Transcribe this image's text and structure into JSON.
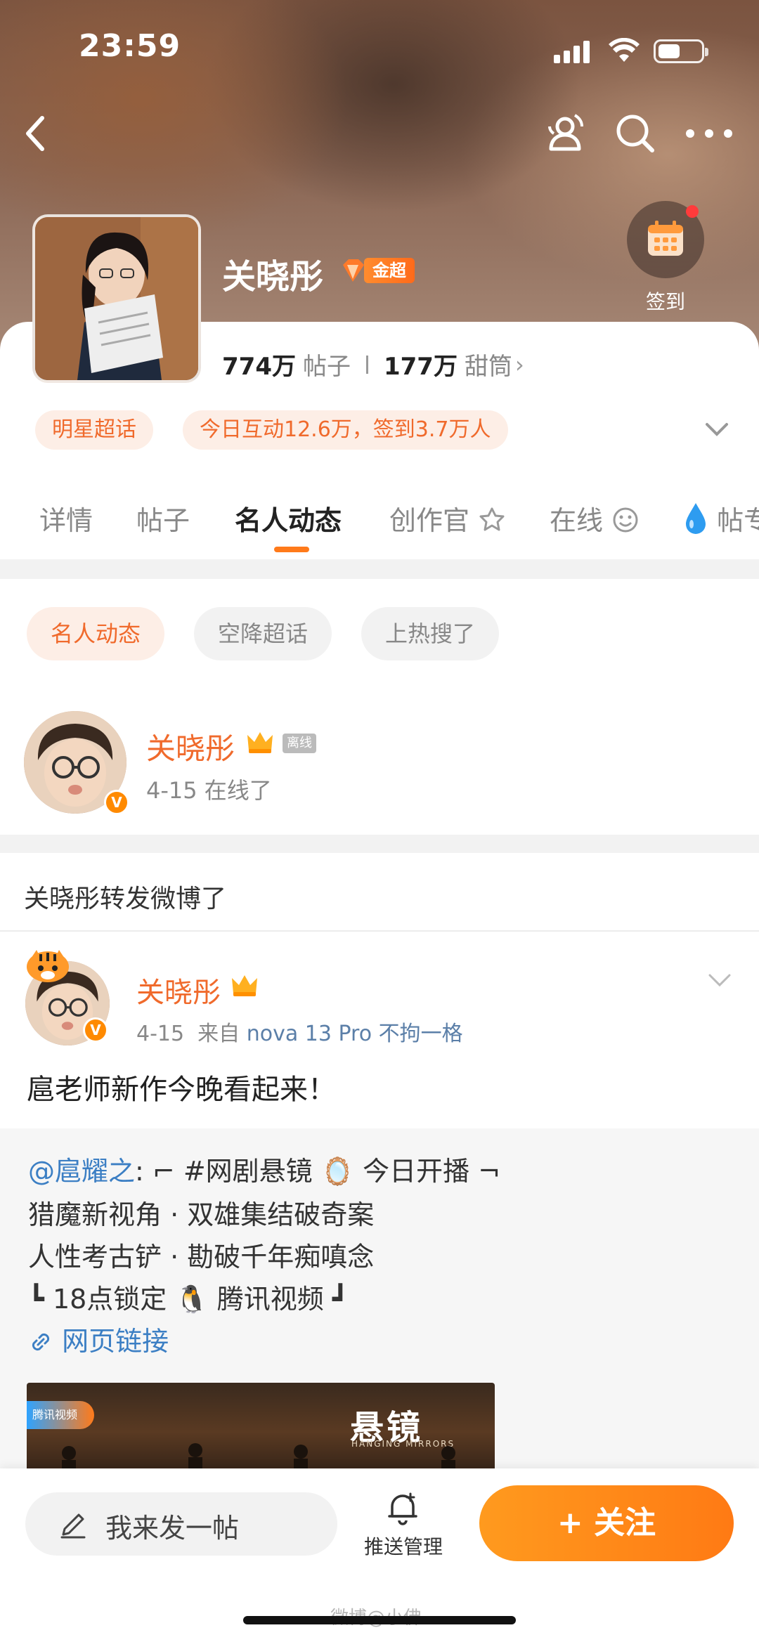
{
  "status_bar": {
    "time": "23:59"
  },
  "profile": {
    "name": "关晓彤",
    "level_badge": "金超",
    "posts_count": "774万",
    "posts_label": "帖子",
    "fans_count": "177万",
    "fans_label": "甜筒",
    "checkin_label": "签到"
  },
  "chips": {
    "category": "明星超话",
    "activity": "今日互动12.6万，签到3.7万人"
  },
  "tabs": [
    "详情",
    "帖子",
    "名人动态",
    "创作官",
    "在线",
    "帖专"
  ],
  "active_tab": "名人动态",
  "filters": [
    "名人动态",
    "空降超话",
    "上热搜了"
  ],
  "online_card": {
    "name": "关晓彤",
    "status_tag": "离线",
    "time": "4-15 在线了"
  },
  "repost": {
    "title": "关晓彤转发微博了",
    "author": "关晓彤",
    "date": "4-15",
    "from_prefix": "来自",
    "device": "nova 13 Pro 不拘一格",
    "text": "扈老师新作今晚看起来！",
    "quote": {
      "mention": "@扈耀之",
      "line1_rest": ": ⌐ #网剧悬镜 🪞 今日开播 ¬",
      "line2": "猎魔新视角 · 双雄集结破奇案",
      "line3": "人性考古铲 · 勘破千年痴嗔念",
      "line4": "┗ 18点锁定 🐧 腾讯视频 ┛",
      "link": "网页链接",
      "image_title": "悬镜",
      "image_subtitle": "HANGING MIRRORS",
      "image_logo": "腾讯视频"
    }
  },
  "bottom_bar": {
    "compose": "我来发一帖",
    "push": "推送管理",
    "follow": "+ 关注"
  },
  "watermark": "微博@小佛",
  "colors": {
    "accent": "#ff7a14",
    "link": "#3c7fc4",
    "name": "#f06a2c"
  }
}
